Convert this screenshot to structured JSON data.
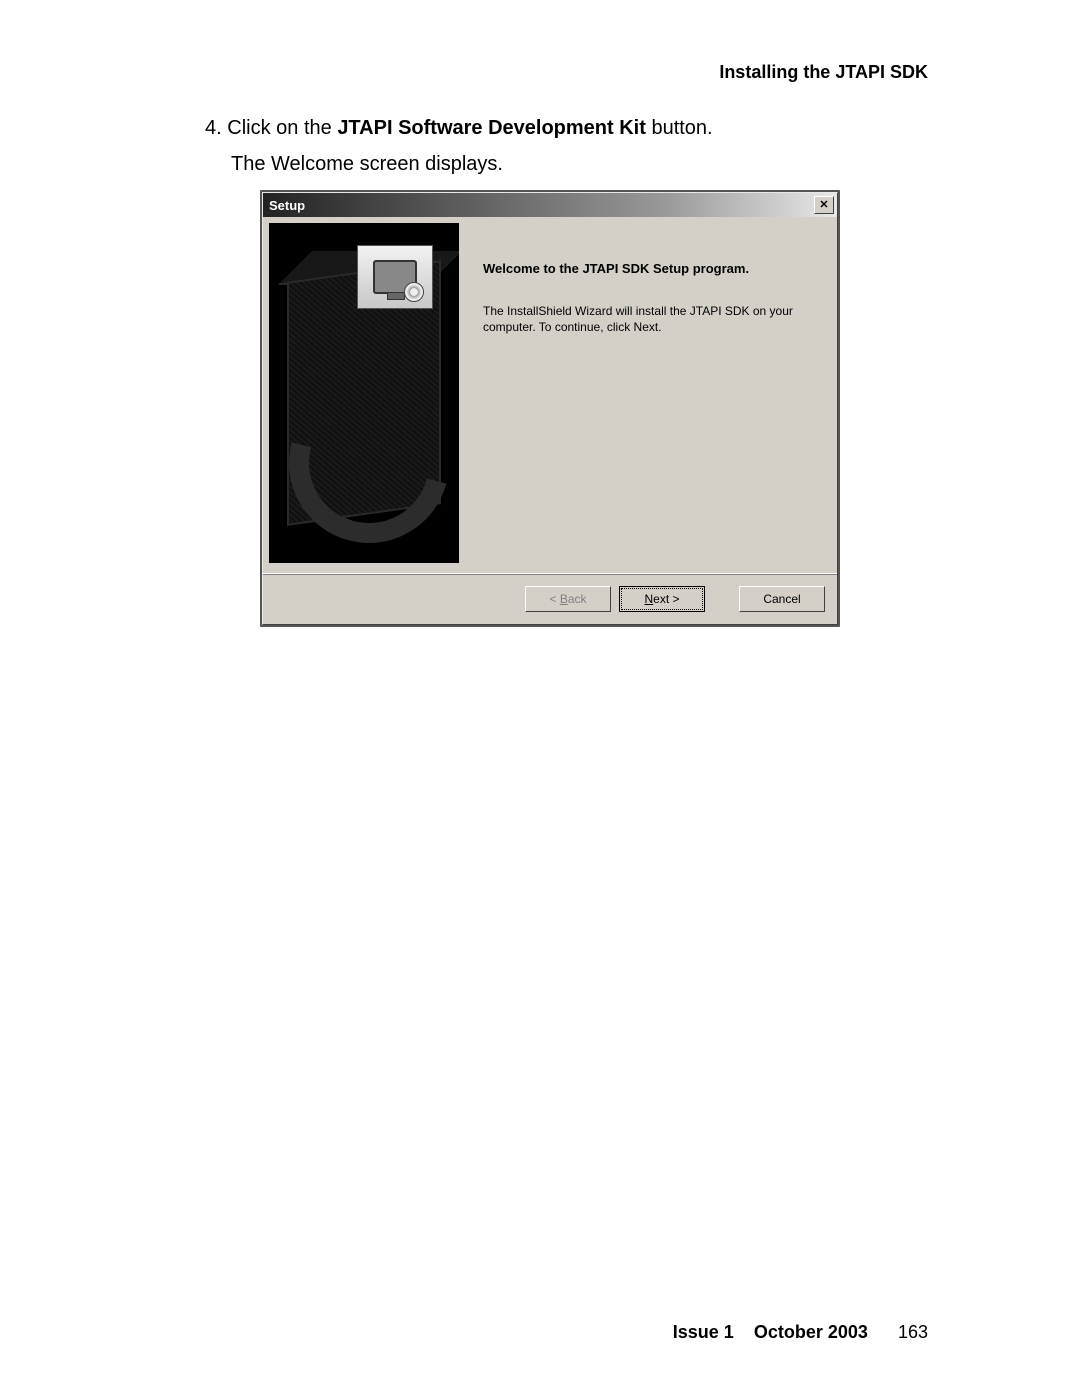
{
  "header": {
    "title": "Installing the JTAPI SDK"
  },
  "instruction": {
    "number": "4.",
    "prefix": "Click on the ",
    "bold": "JTAPI Software Development Kit",
    "suffix": " button.",
    "line2": "The Welcome screen displays."
  },
  "setup": {
    "title": "Setup",
    "close_glyph": "✕",
    "heading": "Welcome to the JTAPI SDK Setup program.",
    "body": "The InstallShield Wizard will install the JTAPI SDK on your computer. To continue, click Next.",
    "buttons": {
      "back_prefix": "< ",
      "back_u": "B",
      "back_rest": "ack",
      "next_u": "N",
      "next_rest": "ext >",
      "cancel": "Cancel"
    }
  },
  "footer": {
    "issue": "Issue 1",
    "date": "October 2003",
    "page": "163"
  }
}
